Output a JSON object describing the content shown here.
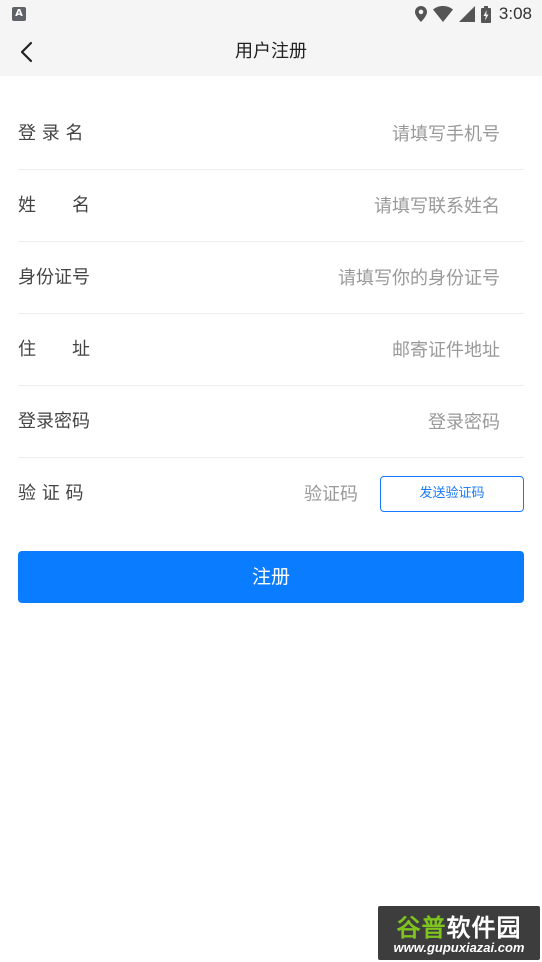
{
  "status_bar": {
    "app_badge": "A",
    "time": "3:08"
  },
  "header": {
    "title": "用户注册"
  },
  "form": {
    "fields": [
      {
        "label": "登 录 名",
        "placeholder": "请填写手机号"
      },
      {
        "label": "姓　　名",
        "placeholder": "请填写联系姓名"
      },
      {
        "label": "身份证号",
        "placeholder": "请填写你的身份证号"
      },
      {
        "label": "住　　址",
        "placeholder": "邮寄证件地址"
      },
      {
        "label": "登录密码",
        "placeholder": "登录密码"
      },
      {
        "label": "验 证 码",
        "placeholder": "验证码"
      }
    ],
    "send_code_label": "发送验证码",
    "submit_label": "注册"
  },
  "watermark": {
    "title_part1": "谷普",
    "title_part2": "软件园",
    "url": "www.gupuxiazai.com"
  },
  "colors": {
    "accent": "#0a7cff",
    "header_bg": "#f5f5f5",
    "divider": "#eeeeee",
    "placeholder": "#999999"
  }
}
